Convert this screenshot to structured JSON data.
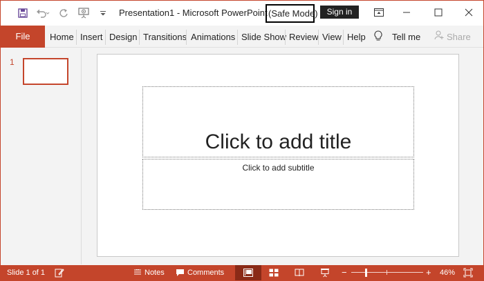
{
  "app": {
    "title": "Presentation1  -  Microsoft PowerPoint",
    "safe_mode": "(Safe Mode)",
    "sign_in": "Sign in"
  },
  "qat": {
    "save_icon": "save-icon",
    "undo_icon": "undo-icon",
    "redo_icon": "redo-icon",
    "present_icon": "present-from-start-icon",
    "customize_icon": "customize-qat-icon"
  },
  "window_controls": [
    "ribbon-display-options-icon",
    "minimize-icon",
    "maximize-icon",
    "close-icon"
  ],
  "ribbon": {
    "file": "File",
    "tabs": [
      "Home",
      "Insert",
      "Design",
      "Transitions",
      "Animations",
      "Slide Show",
      "Review",
      "View",
      "Help"
    ],
    "tell_me": "Tell me",
    "share": "Share"
  },
  "thumbnails": [
    {
      "number": "1"
    }
  ],
  "slide": {
    "title_placeholder": "Click to add title",
    "subtitle_placeholder": "Click to add subtitle"
  },
  "status": {
    "slide_counter": "Slide 1 of 1",
    "notes": "Notes",
    "comments": "Comments",
    "zoom": "46%",
    "zoom_minus": "−",
    "zoom_plus": "+"
  },
  "colors": {
    "accent": "#c4452b",
    "accent_dark": "#8a2a17"
  }
}
